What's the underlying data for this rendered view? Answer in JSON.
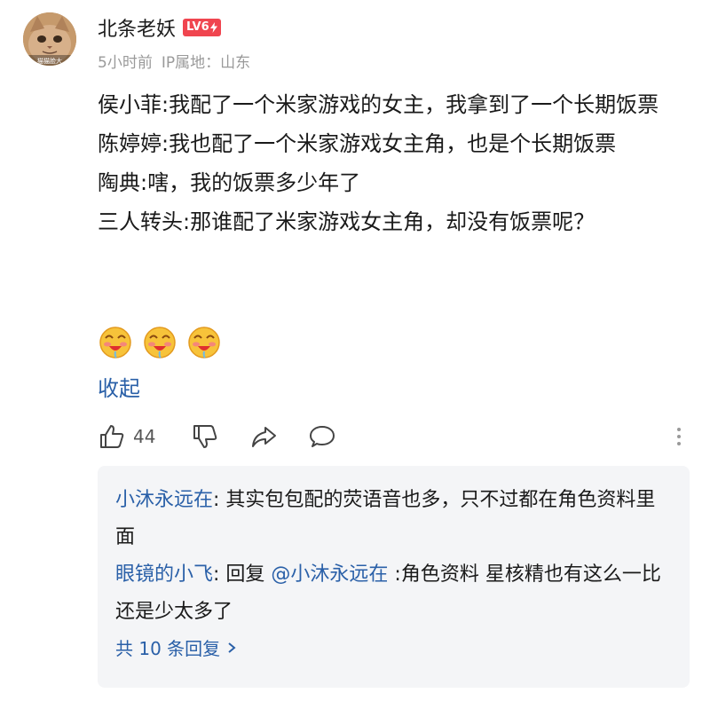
{
  "author": {
    "name": "北条老妖",
    "level_badge": "LV6",
    "time": "5小时前",
    "ip_location": "IP属地：山东",
    "avatar_caption": "猫猫脸大"
  },
  "post": {
    "lines": [
      "侯小菲:我配了一个米家游戏的女主，我拿到了一个长期饭票",
      "陈婷婷:我也配了一个米家游戏女主角，也是个长期饭票",
      "陶典:嗐，我的饭票多少年了",
      "三人转头:那谁配了米家游戏女主角，却没有饭票呢？"
    ],
    "emoji_count": 3,
    "collapse_label": "收起"
  },
  "actions": {
    "like_count": "44",
    "icons": [
      "thumbs-up-icon",
      "thumbs-down-icon",
      "share-icon",
      "comment-icon",
      "more-icon"
    ]
  },
  "replies": [
    {
      "user": "小沐永远在",
      "text": ": 其实包包配的荧语音也多，只不过都在角色资料里面"
    },
    {
      "user": "眼镜的小飞",
      "prefix": ": 回复 ",
      "mention": "@小沐永远在",
      "text": " :角色资料 星核精也有这么一比还是少太多了"
    }
  ],
  "more_replies_label": "共 10 条回复",
  "colors": {
    "link": "#2a60a8",
    "badge": "#f0454f",
    "meta": "#9a9a9a",
    "reply_bg": "#f4f5f7"
  }
}
